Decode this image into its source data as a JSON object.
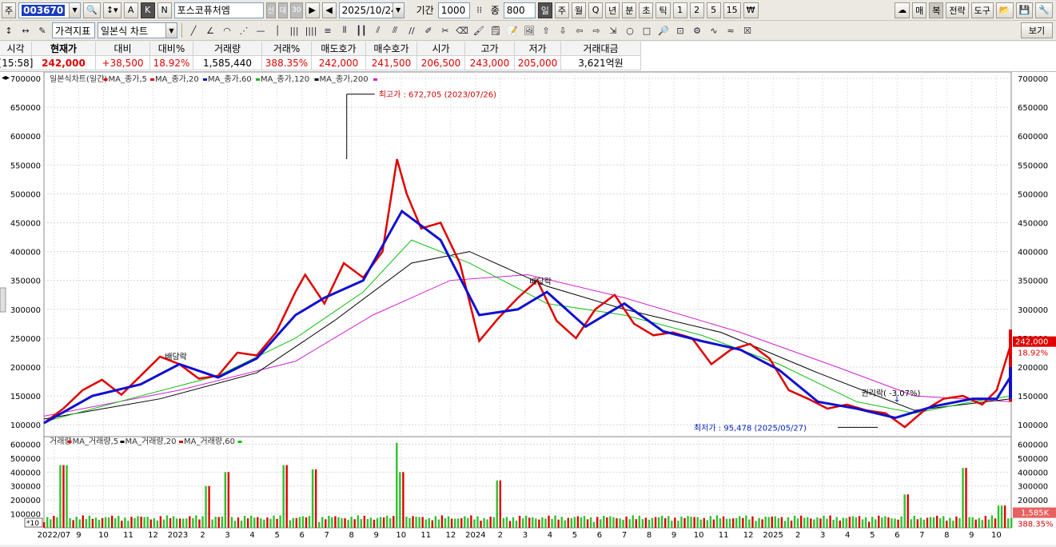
{
  "toolbar1": {
    "prefix": "주",
    "code": "003670",
    "name": "포스코퓨처엠",
    "badges": [
      "신",
      "대",
      "30"
    ],
    "date": "2025/10/24",
    "period_label": "기간",
    "period": "1000",
    "count_label": "종",
    "count": "800",
    "intervals": [
      "일",
      "주",
      "월",
      "Q",
      "년",
      "분",
      "초",
      "틱",
      "1",
      "2",
      "5",
      "15"
    ],
    "right_buttons": [
      "매",
      "복",
      "전략",
      "도구"
    ],
    "akn": [
      "A",
      "K",
      "N"
    ]
  },
  "toolbar2": {
    "price_indicator": "가격지표",
    "chart_type": "일본식 차트",
    "view": "보기"
  },
  "quote": {
    "headers": [
      "시각",
      "현재가",
      "대비",
      "대비%",
      "거래량",
      "거래%",
      "매도호가",
      "매수호가",
      "시가",
      "고가",
      "저가",
      "거래대금"
    ],
    "values": [
      "[15:58]",
      "242,000",
      "+38,500",
      "18.92%",
      "1,585,440",
      "388.35%",
      "242,000",
      "241,500",
      "206,500",
      "243,000",
      "205,000",
      "3,621억원"
    ]
  },
  "legend_price": [
    {
      "label": "일본식차트(일간)",
      "color": "#e00000"
    },
    {
      "label": "MA_종가,5",
      "color": "#e00000"
    },
    {
      "label": "MA_종가,20",
      "color": "#1010d0"
    },
    {
      "label": "MA_종가,60",
      "color": "#10c010"
    },
    {
      "label": "MA_종가,120",
      "color": "#000000"
    },
    {
      "label": "MA_종가,200",
      "color": "#d020d0"
    }
  ],
  "legend_volume": [
    {
      "label": "거래량",
      "color": "#e00000"
    },
    {
      "label": "MA_거래량,5",
      "color": "#000000"
    },
    {
      "label": "MA_거래량,20",
      "color": "#e00000"
    },
    {
      "label": "MA_거래량,60",
      "color": "#10c010"
    }
  ],
  "annotations": {
    "high": "최고가 : 672,705 (2023/07/26)",
    "low": "최저가 : 95,478 (2025/05/27)",
    "dividend1": "배당락",
    "dividend2": "배당락",
    "rights": "권리락( -3.07%)"
  },
  "last_price_tag": {
    "price": "242,000",
    "pct": "18.92%"
  },
  "last_volume_tag": {
    "vol": "1,585K",
    "pct": "388.35%"
  },
  "volume_scale_note": "*10",
  "chart_data": {
    "type": "line",
    "price_axis": {
      "ticks": [
        100000,
        150000,
        200000,
        250000,
        300000,
        350000,
        400000,
        450000,
        500000,
        550000,
        600000,
        650000,
        700000
      ],
      "labels": [
        "100000",
        "150000",
        "200000",
        "250000",
        "300000",
        "350000",
        "400000",
        "450000",
        "500000",
        "550000",
        "600000",
        "650000",
        "700000"
      ],
      "ylim": [
        85000,
        700000
      ]
    },
    "volume_axis": {
      "ticks": [
        100000,
        200000,
        300000,
        400000,
        500000,
        600000
      ],
      "labels": [
        "100000",
        "200000",
        "300000",
        "400000",
        "500000",
        "600000"
      ],
      "ylim": [
        0,
        620000
      ]
    },
    "x_labels": [
      "2022/07",
      "9",
      "10",
      "11",
      "12",
      "2023",
      "2",
      "3",
      "4",
      "5",
      "6",
      "7",
      "8",
      "9",
      "10",
      "11",
      "12",
      "2024",
      "2",
      "3",
      "4",
      "5",
      "6",
      "7",
      "8",
      "9",
      "10",
      "11",
      "12",
      "2025",
      "2",
      "3",
      "4",
      "5",
      "6",
      "7",
      "8",
      "9",
      "10"
    ],
    "series_close": [
      {
        "t": 0,
        "v": 103000
      },
      {
        "t": 0.02,
        "v": 128000
      },
      {
        "t": 0.04,
        "v": 160000
      },
      {
        "t": 0.06,
        "v": 178000
      },
      {
        "t": 0.08,
        "v": 152000
      },
      {
        "t": 0.1,
        "v": 185000
      },
      {
        "t": 0.12,
        "v": 218000
      },
      {
        "t": 0.14,
        "v": 205000
      },
      {
        "t": 0.16,
        "v": 180000
      },
      {
        "t": 0.18,
        "v": 185000
      },
      {
        "t": 0.2,
        "v": 225000
      },
      {
        "t": 0.22,
        "v": 220000
      },
      {
        "t": 0.24,
        "v": 260000
      },
      {
        "t": 0.26,
        "v": 330000
      },
      {
        "t": 0.27,
        "v": 360000
      },
      {
        "t": 0.29,
        "v": 310000
      },
      {
        "t": 0.31,
        "v": 380000
      },
      {
        "t": 0.33,
        "v": 355000
      },
      {
        "t": 0.35,
        "v": 400000
      },
      {
        "t": 0.365,
        "v": 560000
      },
      {
        "t": 0.375,
        "v": 500000
      },
      {
        "t": 0.39,
        "v": 440000
      },
      {
        "t": 0.41,
        "v": 450000
      },
      {
        "t": 0.43,
        "v": 380000
      },
      {
        "t": 0.45,
        "v": 245000
      },
      {
        "t": 0.47,
        "v": 285000
      },
      {
        "t": 0.49,
        "v": 320000
      },
      {
        "t": 0.51,
        "v": 350000
      },
      {
        "t": 0.53,
        "v": 280000
      },
      {
        "t": 0.55,
        "v": 250000
      },
      {
        "t": 0.57,
        "v": 300000
      },
      {
        "t": 0.59,
        "v": 325000
      },
      {
        "t": 0.61,
        "v": 275000
      },
      {
        "t": 0.63,
        "v": 255000
      },
      {
        "t": 0.65,
        "v": 260000
      },
      {
        "t": 0.67,
        "v": 250000
      },
      {
        "t": 0.69,
        "v": 205000
      },
      {
        "t": 0.71,
        "v": 230000
      },
      {
        "t": 0.73,
        "v": 240000
      },
      {
        "t": 0.75,
        "v": 215000
      },
      {
        "t": 0.77,
        "v": 160000
      },
      {
        "t": 0.79,
        "v": 145000
      },
      {
        "t": 0.81,
        "v": 128000
      },
      {
        "t": 0.83,
        "v": 135000
      },
      {
        "t": 0.85,
        "v": 125000
      },
      {
        "t": 0.87,
        "v": 120000
      },
      {
        "t": 0.89,
        "v": 96000
      },
      {
        "t": 0.91,
        "v": 125000
      },
      {
        "t": 0.93,
        "v": 145000
      },
      {
        "t": 0.95,
        "v": 150000
      },
      {
        "t": 0.97,
        "v": 135000
      },
      {
        "t": 0.985,
        "v": 160000
      },
      {
        "t": 1.0,
        "v": 242000
      }
    ],
    "series_ma20": [
      {
        "t": 0,
        "v": 103000
      },
      {
        "t": 0.05,
        "v": 150000
      },
      {
        "t": 0.1,
        "v": 170000
      },
      {
        "t": 0.14,
        "v": 205000
      },
      {
        "t": 0.18,
        "v": 182000
      },
      {
        "t": 0.22,
        "v": 215000
      },
      {
        "t": 0.26,
        "v": 290000
      },
      {
        "t": 0.29,
        "v": 320000
      },
      {
        "t": 0.33,
        "v": 350000
      },
      {
        "t": 0.37,
        "v": 470000
      },
      {
        "t": 0.41,
        "v": 420000
      },
      {
        "t": 0.45,
        "v": 290000
      },
      {
        "t": 0.49,
        "v": 300000
      },
      {
        "t": 0.52,
        "v": 330000
      },
      {
        "t": 0.56,
        "v": 270000
      },
      {
        "t": 0.6,
        "v": 310000
      },
      {
        "t": 0.64,
        "v": 262000
      },
      {
        "t": 0.68,
        "v": 245000
      },
      {
        "t": 0.72,
        "v": 230000
      },
      {
        "t": 0.76,
        "v": 195000
      },
      {
        "t": 0.8,
        "v": 140000
      },
      {
        "t": 0.84,
        "v": 128000
      },
      {
        "t": 0.88,
        "v": 112000
      },
      {
        "t": 0.92,
        "v": 132000
      },
      {
        "t": 0.96,
        "v": 145000
      },
      {
        "t": 0.985,
        "v": 145000
      },
      {
        "t": 1.0,
        "v": 185000
      }
    ],
    "series_ma60": [
      {
        "t": 0,
        "v": 105000
      },
      {
        "t": 0.1,
        "v": 150000
      },
      {
        "t": 0.18,
        "v": 185000
      },
      {
        "t": 0.26,
        "v": 250000
      },
      {
        "t": 0.33,
        "v": 330000
      },
      {
        "t": 0.38,
        "v": 420000
      },
      {
        "t": 0.44,
        "v": 380000
      },
      {
        "t": 0.52,
        "v": 310000
      },
      {
        "t": 0.6,
        "v": 290000
      },
      {
        "t": 0.68,
        "v": 255000
      },
      {
        "t": 0.76,
        "v": 205000
      },
      {
        "t": 0.84,
        "v": 140000
      },
      {
        "t": 0.9,
        "v": 120000
      },
      {
        "t": 0.96,
        "v": 140000
      },
      {
        "t": 1.0,
        "v": 150000
      }
    ],
    "series_ma120": [
      {
        "t": 0,
        "v": 110000
      },
      {
        "t": 0.12,
        "v": 145000
      },
      {
        "t": 0.22,
        "v": 190000
      },
      {
        "t": 0.3,
        "v": 280000
      },
      {
        "t": 0.38,
        "v": 380000
      },
      {
        "t": 0.44,
        "v": 400000
      },
      {
        "t": 0.52,
        "v": 340000
      },
      {
        "t": 0.6,
        "v": 300000
      },
      {
        "t": 0.7,
        "v": 260000
      },
      {
        "t": 0.8,
        "v": 190000
      },
      {
        "t": 0.9,
        "v": 125000
      },
      {
        "t": 1.0,
        "v": 145000
      }
    ],
    "series_ma200": [
      {
        "t": 0,
        "v": 115000
      },
      {
        "t": 0.14,
        "v": 160000
      },
      {
        "t": 0.26,
        "v": 210000
      },
      {
        "t": 0.34,
        "v": 290000
      },
      {
        "t": 0.42,
        "v": 350000
      },
      {
        "t": 0.5,
        "v": 360000
      },
      {
        "t": 0.6,
        "v": 320000
      },
      {
        "t": 0.72,
        "v": 260000
      },
      {
        "t": 0.82,
        "v": 200000
      },
      {
        "t": 0.9,
        "v": 150000
      },
      {
        "t": 1.0,
        "v": 140000
      }
    ],
    "volume_peaks": [
      {
        "t": 0.02,
        "v": 450000
      },
      {
        "t": 0.17,
        "v": 300000
      },
      {
        "t": 0.19,
        "v": 400000
      },
      {
        "t": 0.25,
        "v": 450000
      },
      {
        "t": 0.28,
        "v": 420000
      },
      {
        "t": 0.365,
        "v": 610000
      },
      {
        "t": 0.37,
        "v": 400000
      },
      {
        "t": 0.47,
        "v": 340000
      },
      {
        "t": 0.89,
        "v": 240000
      },
      {
        "t": 0.95,
        "v": 430000
      },
      {
        "t": 0.99,
        "v": 160000
      }
    ]
  }
}
